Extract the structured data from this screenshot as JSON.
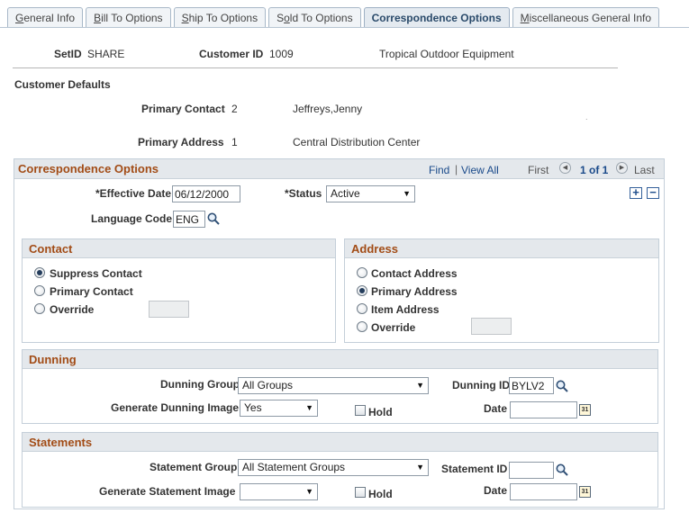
{
  "tabs": [
    {
      "pre": "",
      "acc": "G",
      "post": "eneral Info"
    },
    {
      "pre": "",
      "acc": "B",
      "post": "ill To Options"
    },
    {
      "pre": "",
      "acc": "S",
      "post": "hip To Options"
    },
    {
      "pre": "S",
      "acc": "o",
      "post": "ld To Options"
    },
    {
      "pre": "",
      "acc": "",
      "post": "Correspondence Options"
    },
    {
      "pre": "",
      "acc": "M",
      "post": "iscellaneous General Info"
    }
  ],
  "header": {
    "setid_label": "SetID",
    "setid_value": "SHARE",
    "customer_id_label": "Customer ID",
    "customer_id_value": "1009",
    "customer_name": "Tropical Outdoor Equipment"
  },
  "defaults": {
    "title": "Customer Defaults",
    "primary_contact_label": "Primary Contact",
    "primary_contact_num": "2",
    "primary_contact_name": "Jeffreys,Jenny",
    "primary_address_label": "Primary Address",
    "primary_address_num": "1",
    "primary_address_name": "Central Distribution Center",
    "stray_mark": "."
  },
  "corr": {
    "title": "Correspondence Options",
    "find": "Find",
    "divider": "|",
    "view_all": "View All",
    "first": "First",
    "count": "1 of 1",
    "last": "Last",
    "eff_date_label": "*Effective Date",
    "eff_date_value": "06/12/2000",
    "status_label": "*Status",
    "status_value": "Active",
    "lang_label": "Language Code",
    "lang_value": "ENG"
  },
  "contact": {
    "title": "Contact",
    "options": [
      "Suppress Contact",
      "Primary Contact",
      "Override"
    ],
    "selected": 0,
    "override_value": ""
  },
  "address": {
    "title": "Address",
    "options": [
      "Contact Address",
      "Primary Address",
      "Item Address",
      "Override"
    ],
    "selected": 1,
    "override_value": ""
  },
  "dunning": {
    "title": "Dunning",
    "group_label": "Dunning Group",
    "group_value": "All Groups",
    "id_label": "Dunning ID",
    "id_value": "BYLV2",
    "image_label": "Generate Dunning Image",
    "image_value": "Yes",
    "hold_label": "Hold",
    "date_label": "Date",
    "date_value": ""
  },
  "statements": {
    "title": "Statements",
    "group_label": "Statement Group",
    "group_value": "All Statement Groups",
    "id_label": "Statement ID",
    "id_value": "",
    "image_label": "Generate Statement Image",
    "image_value": "",
    "hold_label": "Hold",
    "date_label": "Date",
    "date_value": ""
  },
  "icons": {
    "calendar_glyph": "31",
    "plus_glyph": "+",
    "minus_glyph": "−",
    "prev_glyph": "◀",
    "next_glyph": "▶",
    "dropdown_glyph": "▼"
  }
}
